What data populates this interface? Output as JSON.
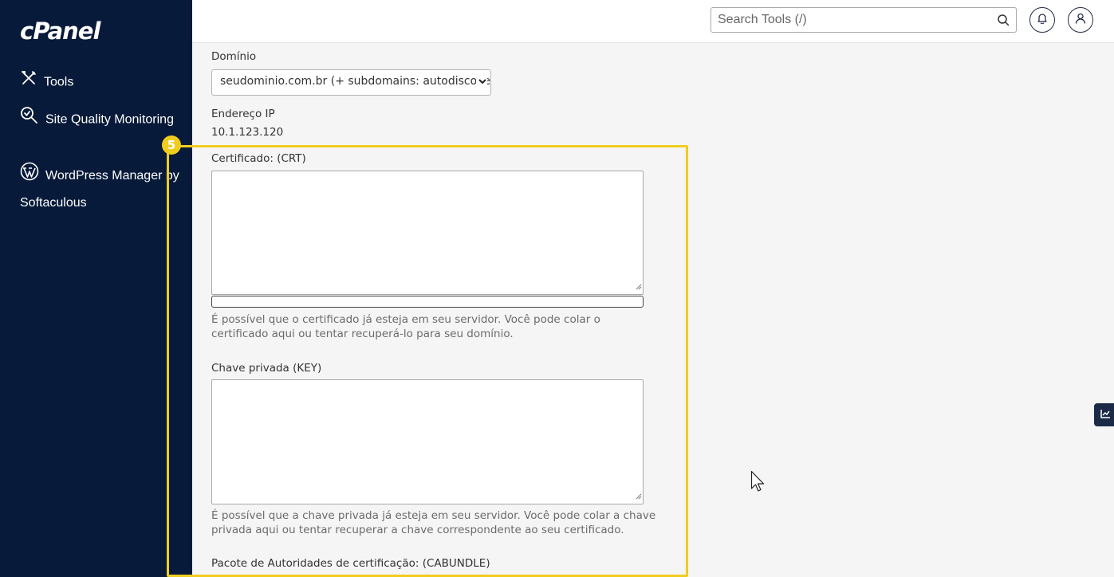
{
  "sidebar": {
    "logo": "cPanel",
    "items": [
      {
        "label": "Tools",
        "icon": "tools-icon"
      },
      {
        "label": "Site Quality Monitoring",
        "icon": "site-quality-icon"
      },
      {
        "label": "WordPress Manager by Softaculous",
        "icon": "wordpress-icon"
      }
    ]
  },
  "header": {
    "search_placeholder": "Search Tools (/)",
    "notifications_icon": "bell-icon",
    "user_icon": "user-icon"
  },
  "form": {
    "domain_label": "Domínio",
    "domain_value": "seudominio.com.br  (+ subdomains: autodiscover",
    "ip_label": "Endereço IP",
    "ip_value": "10.1.123.120",
    "crt_label": "Certificado: (CRT)",
    "crt_help": "É possível que o certificado já esteja em seu servidor. Você pode colar o certificado aqui ou tentar recuperá-lo para seu domínio.",
    "key_label": "Chave privada (KEY)",
    "key_help": "É possível que a chave privada já esteja em seu servidor. Você pode colar a chave privada aqui ou tentar recuperar a chave correspondente ao seu certificado.",
    "cabundle_label": "Pacote de Autoridades de certificação: (CABUNDLE)"
  },
  "annotation": {
    "step_number": "5",
    "color": "#f0cc1e"
  },
  "colors": {
    "sidebar_bg": "#071a3a",
    "page_bg": "#f5f5f5"
  }
}
